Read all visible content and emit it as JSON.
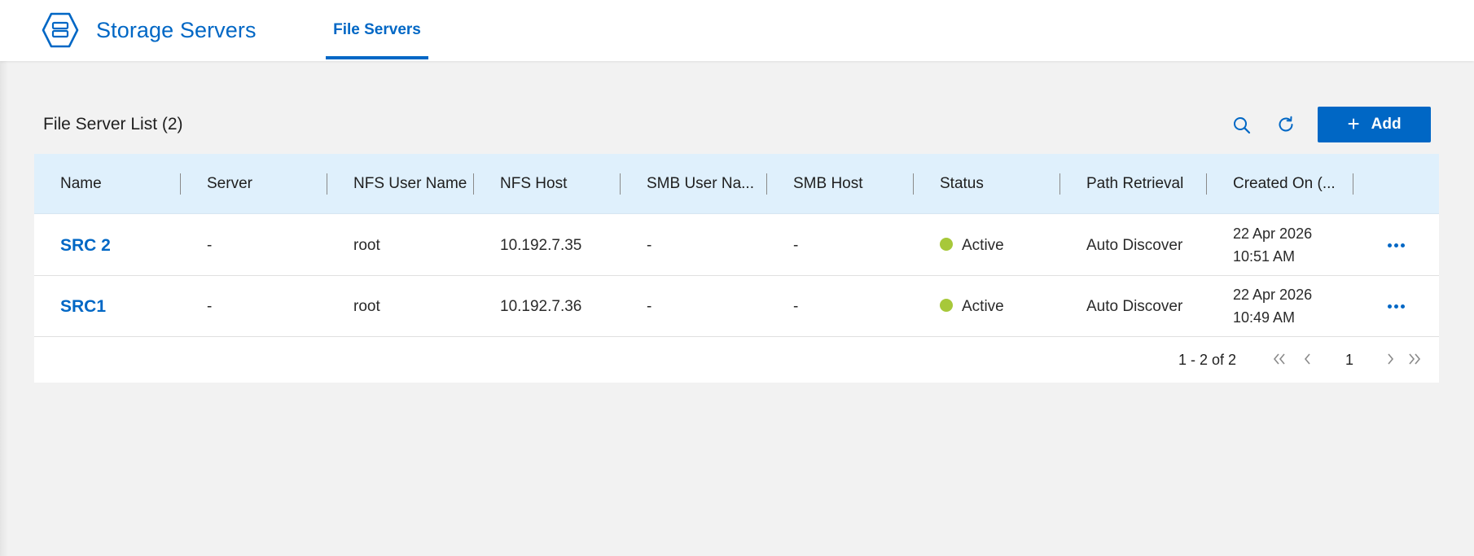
{
  "app": {
    "title": "Storage Servers",
    "brand_icon": "server-hexagon-icon",
    "accent_color": "#0067c5"
  },
  "tabs": [
    {
      "label": "File Servers",
      "active": true
    }
  ],
  "list": {
    "title": "File Server List (2)",
    "add_label": "Add",
    "add_icon": "plus-icon",
    "search_icon": "search-icon",
    "refresh_icon": "refresh-icon"
  },
  "table": {
    "columns": [
      "Name",
      "Server",
      "NFS User Name",
      "NFS Host",
      "SMB User Na...",
      "SMB Host",
      "Status",
      "Path Retrieval",
      "Created On (..."
    ],
    "rows": [
      {
        "name": "SRC 2",
        "server": "-",
        "nfs_user": "root",
        "nfs_host": "10.192.7.35",
        "smb_user": "-",
        "smb_host": "-",
        "status": "Active",
        "status_color": "#a7c83a",
        "path_retrieval": "Auto Discover",
        "created_date": "22 Apr 2026",
        "created_time": "10:51 AM"
      },
      {
        "name": "SRC1",
        "server": "-",
        "nfs_user": "root",
        "nfs_host": "10.192.7.36",
        "smb_user": "-",
        "smb_host": "-",
        "status": "Active",
        "status_color": "#a7c83a",
        "path_retrieval": "Auto Discover",
        "created_date": "22 Apr 2026",
        "created_time": "10:49 AM"
      }
    ]
  },
  "pagination": {
    "range": "1 - 2 of 2",
    "current_page": "1"
  }
}
